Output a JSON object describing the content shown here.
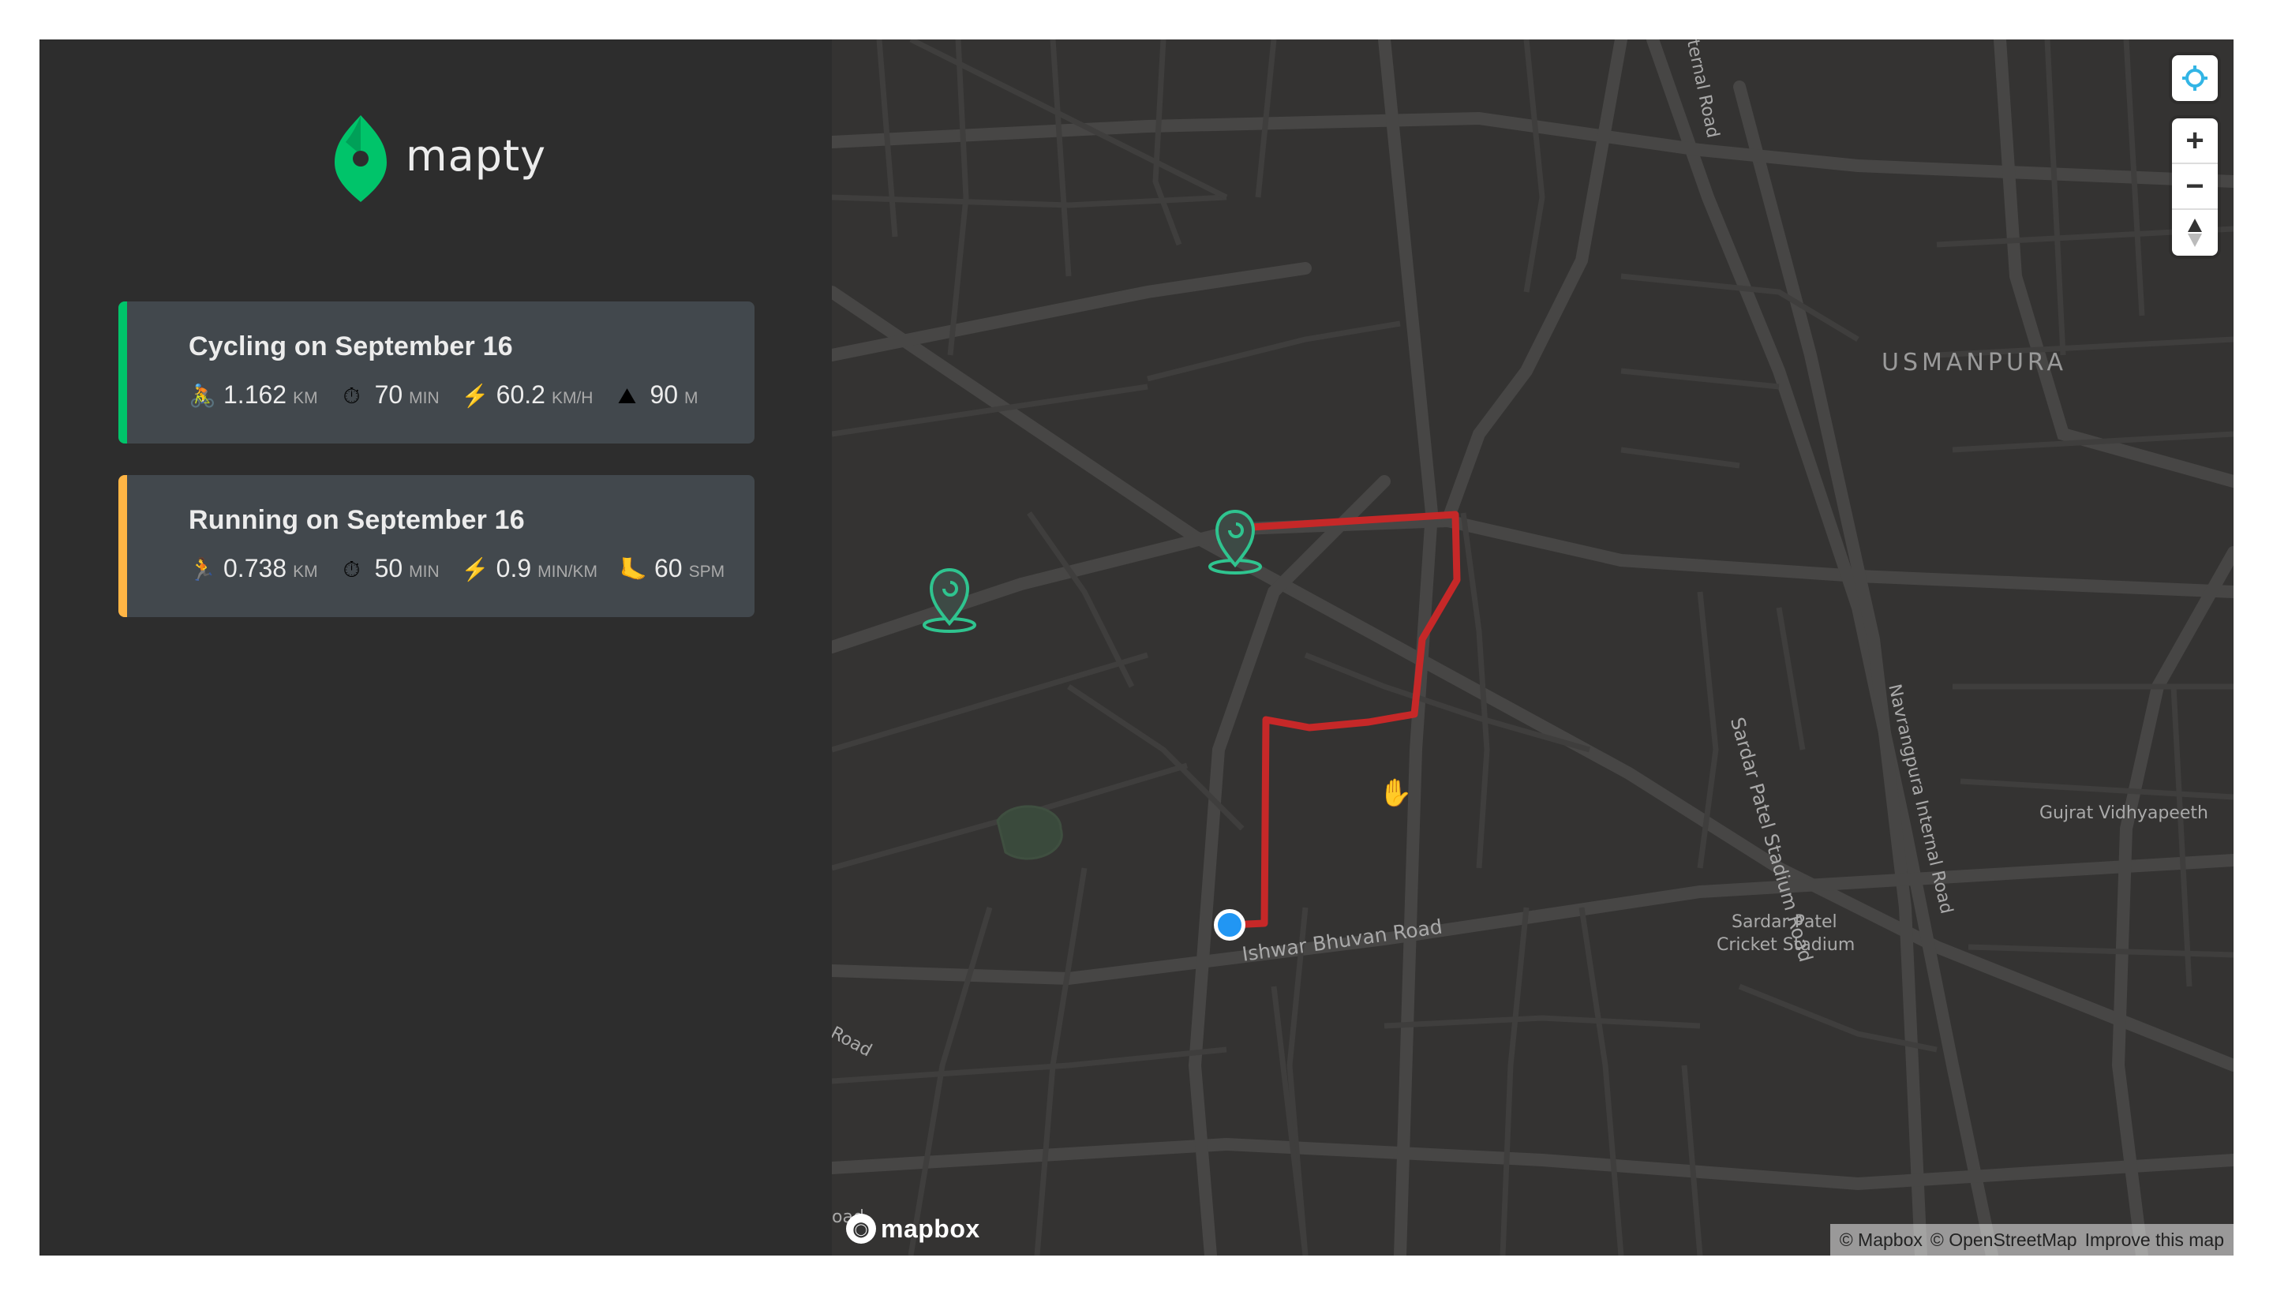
{
  "app": {
    "logo_text": "mapty",
    "logo_color": "#00c46a"
  },
  "workouts": [
    {
      "type": "cycling",
      "title": "Cycling on September 16",
      "accent_color": "#00c46a",
      "stats": [
        {
          "icon": "cycling-icon",
          "glyph": "🚴",
          "value": "1.162",
          "unit": "km"
        },
        {
          "icon": "stopwatch-icon",
          "glyph": "⏱",
          "value": "70",
          "unit": "min"
        },
        {
          "icon": "lightning-icon",
          "glyph": "⚡",
          "value": "60.2",
          "unit": "km/h"
        },
        {
          "icon": "mountain-icon",
          "glyph": "⛰",
          "value": "90",
          "unit": "m"
        }
      ]
    },
    {
      "type": "running",
      "title": "Running on September 16",
      "accent_color": "#ffb545",
      "stats": [
        {
          "icon": "running-icon",
          "glyph": "🏃",
          "value": "0.738",
          "unit": "km"
        },
        {
          "icon": "stopwatch-icon",
          "glyph": "⏱",
          "value": "50",
          "unit": "min"
        },
        {
          "icon": "lightning-icon",
          "glyph": "⚡",
          "value": "0.9",
          "unit": "min/km"
        },
        {
          "icon": "footprint-icon",
          "glyph": "🦶",
          "value": "60",
          "unit": "spm"
        }
      ]
    }
  ],
  "map": {
    "labels": {
      "usmanpura": "USMANPURA",
      "gujrat": "Gujrat Vidhyapeeth",
      "stadium_line1": "Sardar Patel",
      "stadium_line2": "Cricket Stadium",
      "ishwar": "Ishwar Bhuvan Road",
      "sardar_road": "Sardar Patel Stadium Road",
      "navrangpura_road": "Navrangpura Internal Road",
      "internal_road": "ternal Road",
      "road_left": "Road",
      "oad": "oad"
    },
    "route_color": "#c62828",
    "marker_color": "#2fc48f",
    "location_color": "#2196f3",
    "controls": {
      "geolocate": "geolocate-icon",
      "zoom_in": "+",
      "zoom_out": "−",
      "compass": "compass-icon"
    },
    "brand": "mapbox",
    "attribution": [
      "© Mapbox",
      "© OpenStreetMap",
      "Improve this map"
    ]
  }
}
